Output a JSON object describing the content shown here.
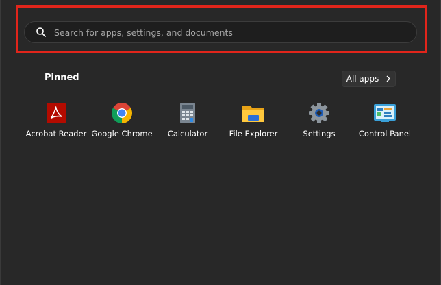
{
  "search": {
    "placeholder": "Search for apps, settings, and documents",
    "value": ""
  },
  "pinned": {
    "title": "Pinned",
    "all_apps_label": "All apps",
    "apps": [
      {
        "label": "Acrobat Reader",
        "icon": "acrobat-reader-icon"
      },
      {
        "label": "Google Chrome",
        "icon": "google-chrome-icon"
      },
      {
        "label": "Calculator",
        "icon": "calculator-icon"
      },
      {
        "label": "File Explorer",
        "icon": "file-explorer-icon"
      },
      {
        "label": "Settings",
        "icon": "settings-gear-icon"
      },
      {
        "label": "Control Panel",
        "icon": "control-panel-icon"
      }
    ]
  },
  "colors": {
    "panel_background": "#282828",
    "highlight_border": "#e1251b",
    "search_background": "#1e1e1e"
  }
}
